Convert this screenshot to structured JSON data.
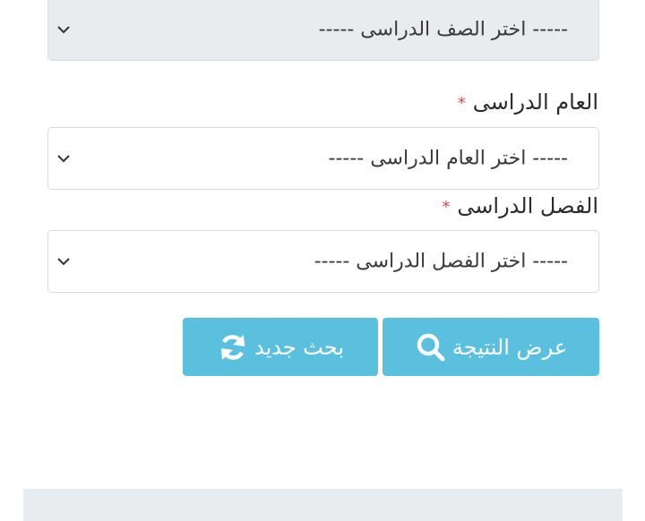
{
  "form": {
    "grade_select": {
      "placeholder": "-----  اختر الصف الدراسى  -----"
    },
    "year_field": {
      "label": "العام الدراسى",
      "required_mark": "*",
      "placeholder": "-----  اختر العام الدراسى  -----"
    },
    "term_field": {
      "label": "الفصل الدراسى",
      "required_mark": "*",
      "placeholder": "-----  اختر الفصل الدراسى  -----"
    }
  },
  "buttons": {
    "show_result": {
      "label": "عرض النتيجة",
      "icon": "search-icon"
    },
    "new_search": {
      "label": "بحث جديد",
      "icon": "refresh-icon"
    }
  },
  "colors": {
    "button": "#5bc0de",
    "required": "#e0434c",
    "disabled_bg": "#e9ecef"
  }
}
